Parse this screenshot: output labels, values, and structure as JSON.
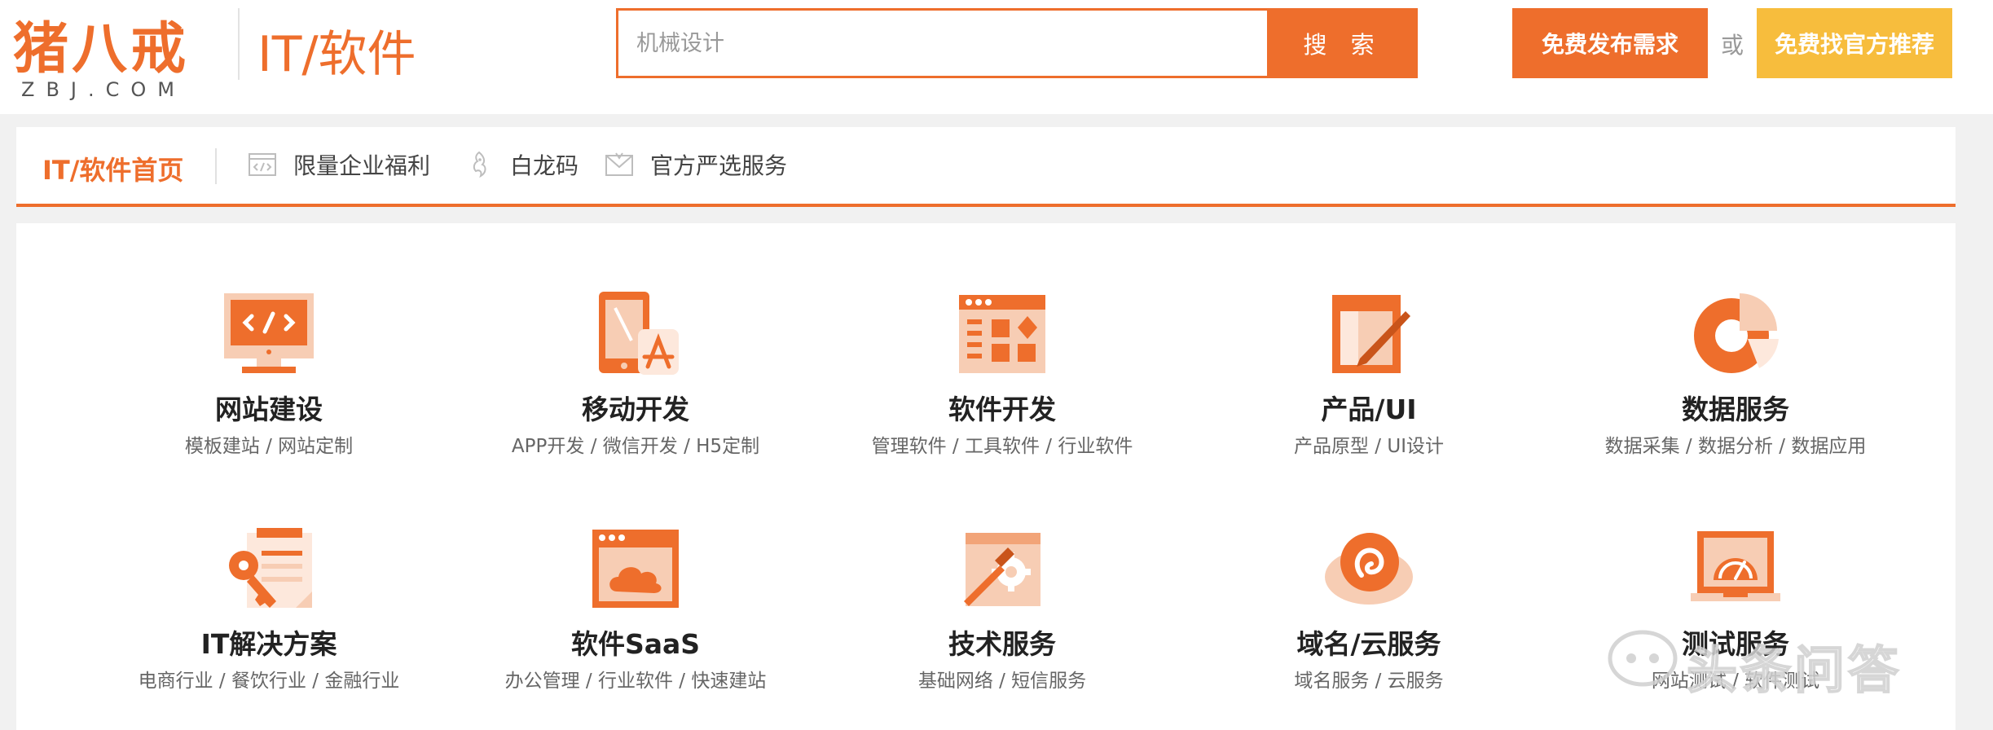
{
  "header": {
    "logo_text": "猪八戒",
    "logo_sub": "ZBJ.COM",
    "site_category": "IT/软件",
    "search": {
      "placeholder": "机械设计",
      "button_label": "搜 索"
    },
    "publish_button": "免费发布需求",
    "or_label": "或",
    "find_button": "免费找官方推荐"
  },
  "nav": {
    "home_label": "IT/软件首页",
    "items": [
      {
        "label": "限量企业福利",
        "icon": "code-window-icon"
      },
      {
        "label": "白龙码",
        "icon": "dragon-icon"
      },
      {
        "label": "官方严选服务",
        "icon": "envelope-icon"
      }
    ]
  },
  "categories": [
    {
      "title": "网站建设",
      "sub": "模板建站 / 网站定制",
      "icon": "monitor-code-icon"
    },
    {
      "title": "移动开发",
      "sub": "APP开发 / 微信开发 / H5定制",
      "icon": "mobile-app-icon"
    },
    {
      "title": "软件开发",
      "sub": "管理软件 / 工具软件 / 行业软件",
      "icon": "software-window-icon"
    },
    {
      "title": "产品/UI",
      "sub": "产品原型 / UI设计",
      "icon": "design-pen-icon"
    },
    {
      "title": "数据服务",
      "sub": "数据采集 / 数据分析 / 数据应用",
      "icon": "pie-chart-icon"
    },
    {
      "title": "IT解决方案",
      "sub": "电商行业 / 餐饮行业 / 金融行业",
      "icon": "key-document-icon"
    },
    {
      "title": "软件SaaS",
      "sub": "办公管理 / 行业软件 / 快速建站",
      "icon": "cloud-window-icon"
    },
    {
      "title": "技术服务",
      "sub": "基础网络 / 短信服务",
      "icon": "wrench-gear-icon"
    },
    {
      "title": "域名/云服务",
      "sub": "域名服务 / 云服务",
      "icon": "cloud-swirl-icon"
    },
    {
      "title": "测试服务",
      "sub": "网站测试 / 软件测试",
      "icon": "gauge-laptop-icon"
    }
  ],
  "watermark": {
    "text": "头条问答"
  },
  "colors": {
    "accent": "#ee6e2c",
    "accent_light": "#f7cdb4",
    "yellow": "#f7bd3d"
  }
}
